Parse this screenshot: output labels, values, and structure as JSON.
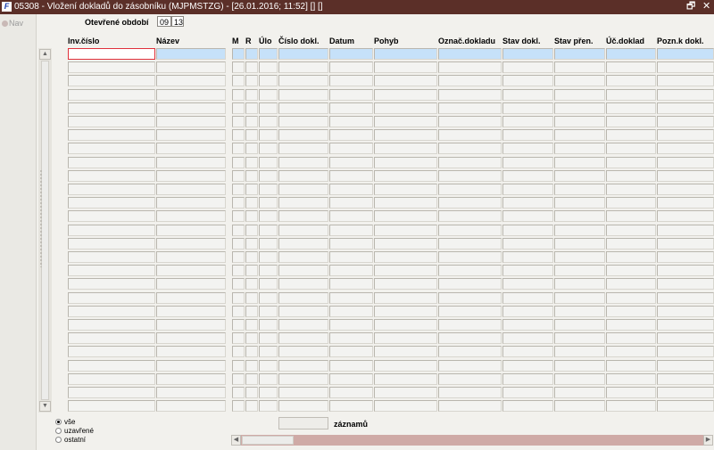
{
  "window": {
    "title": "05308 - Vložení dokladů do zásobníku (MJPMSTZG) - [26.01.2016; 11:52] [] []",
    "restore_glyph": "🗗",
    "close_glyph": "✕",
    "app_icon": "document-form-icon",
    "app_icon_glyph": "F"
  },
  "sidebar": {
    "nav_label": "Nav"
  },
  "period": {
    "label": "Otevřené období",
    "month": "09",
    "year": "13"
  },
  "columns": [
    "Inv.číslo",
    "Název",
    "M",
    "R",
    "Úlo",
    "Číslo dokl.",
    "Datum",
    "Pohyb",
    "Označ.dokladu",
    "Stav dokl.",
    "Stav přen.",
    "Úč.doklad",
    "Pozn.k dokl."
  ],
  "grid": {
    "row_count": 27,
    "selected_row": 1,
    "active_column": 1
  },
  "filter": {
    "options": [
      {
        "label": "vše",
        "selected": true
      },
      {
        "label": "uzavřené",
        "selected": false
      },
      {
        "label": "ostatní",
        "selected": false
      }
    ]
  },
  "records": {
    "count": "",
    "label": "záznamů"
  },
  "colors": {
    "titlebar": "#5b2f28",
    "selected_row": "#c6e1f9",
    "active_cell_border": "#e0303a",
    "hscroll_track": "#cfaaa6"
  }
}
